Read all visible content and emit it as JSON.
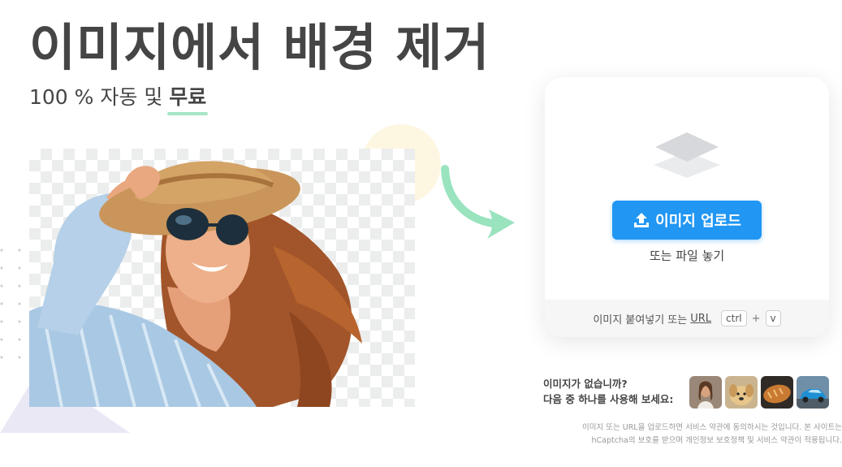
{
  "hero": {
    "title": "이미지에서 배경 제거",
    "subtitle_prefix": "100 % 자동 및",
    "subtitle_highlight": "무료"
  },
  "upload": {
    "button_label": "이미지 업로드",
    "drop_text": "또는 파일 놓기",
    "paste_text": "이미지 붙여넣기 또는",
    "url_link": "URL",
    "key_ctrl": "ctrl",
    "key_plus": "+",
    "key_v": "v"
  },
  "samples": {
    "line1": "이미지가 없습니까?",
    "line2": "다음 중 하나를 사용해 보세요:",
    "items": [
      "person",
      "dog",
      "bread",
      "car"
    ]
  },
  "legal": {
    "line1": "이미지 또는 URL을 업로드하면 서비스 약관에 동의하시는 것입니다. 본 사이트는",
    "line2": "hCaptcha의 보호를 받으며 개인정보 보호정책 및 서비스 약관이 적용됩니다."
  },
  "colors": {
    "accent": "#2196f3",
    "highlight_underline": "#a7e6c8",
    "arrow": "#9ae3bf",
    "text": "#454545"
  }
}
